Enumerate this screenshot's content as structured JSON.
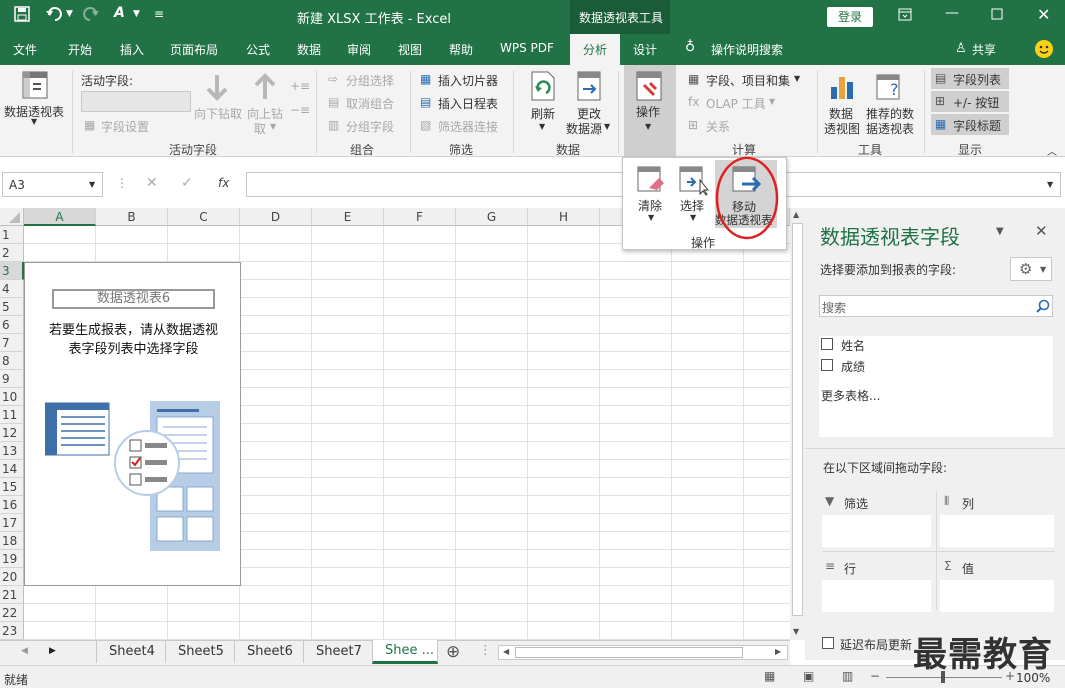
{
  "title": {
    "doc": "新建 XLSX 工作表 - Excel",
    "context_tab": "数据透视表工具",
    "login": "登录"
  },
  "menu": {
    "tabs": [
      "文件",
      "开始",
      "插入",
      "页面布局",
      "公式",
      "数据",
      "审阅",
      "视图",
      "帮助",
      "WPS PDF",
      "分析",
      "设计"
    ],
    "search": "操作说明搜索",
    "share": "共享"
  },
  "ribbon": {
    "pivot_table": "数据透视表",
    "active_field_label": "活动字段:",
    "field_settings": "字段设置",
    "drill_down": "向下钻取",
    "drill_up_1": "向上钻",
    "drill_up_2": "取",
    "group_active": "活动字段",
    "group_selection": "分组选择",
    "ungroup": "取消组合",
    "group_field": "分组字段",
    "group_group": "组合",
    "insert_slicer": "插入切片器",
    "insert_timeline": "插入日程表",
    "filter_connections": "筛选器连接",
    "group_filter": "筛选",
    "refresh": "刷新",
    "change_source_1": "更改",
    "change_source_2": "数据源",
    "group_data": "数据",
    "actions": "操作",
    "fields_items_sets": "字段、项目和集",
    "olap_tools": "OLAP 工具",
    "relationships": "关系",
    "group_calc": "计算",
    "pivot_chart_1": "数据",
    "pivot_chart_2": "透视图",
    "recommended_1": "推荐的数",
    "recommended_2": "据透视表",
    "group_tools": "工具",
    "field_list": "字段列表",
    "buttons": "+/- 按钮",
    "field_headers": "字段标题",
    "group_show": "显示"
  },
  "dropdown": {
    "clear": "清除",
    "select": "选择",
    "move_1": "移动",
    "move_2": "数据透视表",
    "group": "操作"
  },
  "formula": {
    "name_box": "A3",
    "fx": "fx"
  },
  "grid": {
    "columns": [
      "A",
      "B",
      "C",
      "D",
      "E",
      "F",
      "G",
      "H"
    ],
    "rows": [
      "1",
      "2",
      "3",
      "4",
      "5",
      "6",
      "7",
      "8",
      "9",
      "10",
      "11",
      "12",
      "13",
      "14",
      "15",
      "16",
      "17",
      "18",
      "19",
      "20",
      "21",
      "22",
      "23"
    ]
  },
  "pivot_placeholder": {
    "name": "数据透视表6",
    "text_1": "若要生成报表，请从数据透视",
    "text_2": "表字段列表中选择字段"
  },
  "panel": {
    "title": "数据透视表字段",
    "choose_label": "选择要添加到报表的字段:",
    "search_placeholder": "搜索",
    "fields": [
      "姓名",
      "成绩"
    ],
    "more_tables": "更多表格...",
    "drag_label": "在以下区域间拖动字段:",
    "area_filter": "筛选",
    "area_columns": "列",
    "area_rows": "行",
    "area_values": "值",
    "defer_update": "延迟布局更新"
  },
  "sheets": [
    "Sheet4",
    "Sheet5",
    "Sheet6",
    "Sheet7",
    "Shee ..."
  ],
  "status": {
    "ready": "就绪",
    "zoom": "100%"
  },
  "watermark": "最需教育",
  "colors": {
    "excel_green": "#217346",
    "highlight_red": "#e02020",
    "panel_green": "#1e7145"
  }
}
